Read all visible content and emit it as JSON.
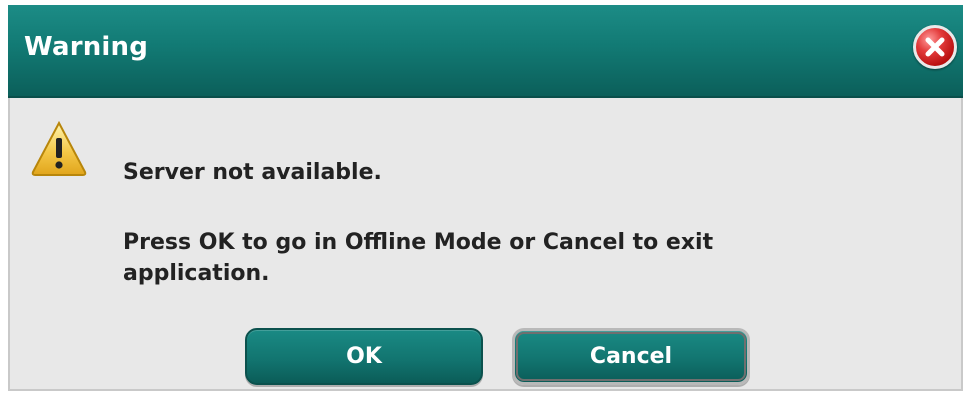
{
  "dialog": {
    "title": "Warning",
    "messages": [
      "Server not available.",
      "Press OK to go in Offline Mode or Cancel to exit application."
    ],
    "buttons": {
      "ok_label": "OK",
      "cancel_label": "Cancel"
    },
    "icons": {
      "close": "close-icon",
      "warning": "warning-icon"
    },
    "colors": {
      "titlebar": "#127a74",
      "button": "#127570",
      "close": "#d62828",
      "warning": "#f2c53d"
    }
  }
}
